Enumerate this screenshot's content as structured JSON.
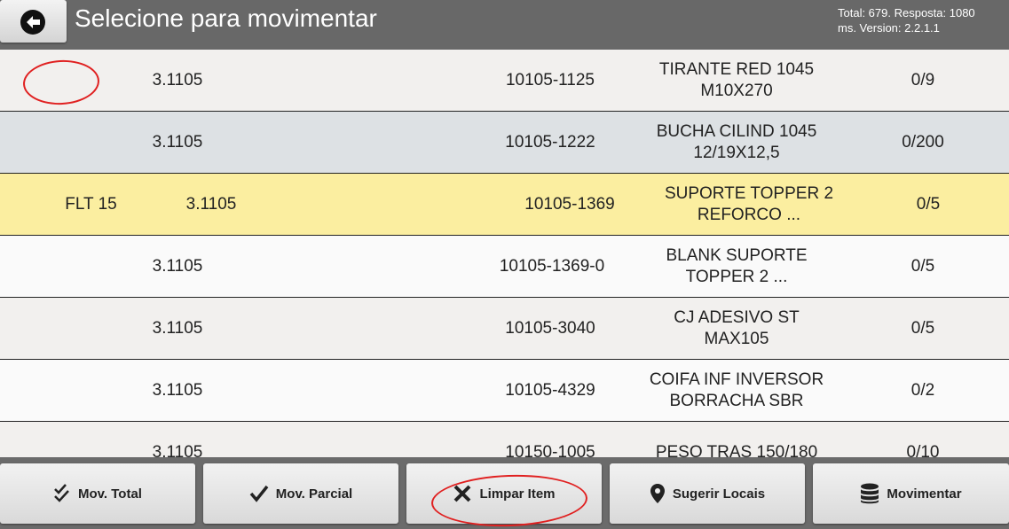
{
  "header": {
    "title": "Selecione para movimentar",
    "status_line1": "Total: 679. Resposta: 1080",
    "status_line2": "ms. Version: 2.2.1.1"
  },
  "colors": {
    "header_bg": "#686868",
    "row_light": "#f2f0ee",
    "row_alt": "#dde1e4",
    "row_white": "#fafafa",
    "row_highlight": "#fbeea0",
    "annotation": "#e02020"
  },
  "rows": [
    {
      "loc": "",
      "code": "3.1105",
      "item": "10105-1125",
      "desc1": "TIRANTE RED 1045",
      "desc2": "M10X270",
      "qty": "0/9"
    },
    {
      "loc": "",
      "code": "3.1105",
      "item": "10105-1222",
      "desc1": "BUCHA CILIND 1045",
      "desc2": "12/19X12,5",
      "qty": "0/200"
    },
    {
      "loc": "FLT 15",
      "code": "3.1105",
      "item": "10105-1369",
      "desc1": "SUPORTE TOPPER 2",
      "desc2": "REFORCO ...",
      "qty": "0/5"
    },
    {
      "loc": "",
      "code": "3.1105",
      "item": "10105-1369-0",
      "desc1": "BLANK SUPORTE",
      "desc2": "TOPPER 2 ...",
      "qty": "0/5"
    },
    {
      "loc": "",
      "code": "3.1105",
      "item": "10105-3040",
      "desc1": "CJ ADESIVO ST",
      "desc2": "MAX105",
      "qty": "0/5"
    },
    {
      "loc": "",
      "code": "3.1105",
      "item": "10105-4329",
      "desc1": "COIFA INF INVERSOR",
      "desc2": "BORRACHA SBR",
      "qty": "0/2"
    },
    {
      "loc": "",
      "code": "3.1105",
      "item": "10150-1005",
      "desc1": "PESO TRAS 150/180",
      "desc2": "",
      "qty": "0/10"
    }
  ],
  "footer": {
    "buttons": [
      {
        "label": "Mov. Total",
        "icon": "double-check-icon"
      },
      {
        "label": "Mov. Parcial",
        "icon": "check-icon"
      },
      {
        "label": "Limpar Item",
        "icon": "x-icon"
      },
      {
        "label": "Sugerir Locais",
        "icon": "location-pin-icon"
      },
      {
        "label": "Movimentar",
        "icon": "database-icon"
      }
    ]
  }
}
